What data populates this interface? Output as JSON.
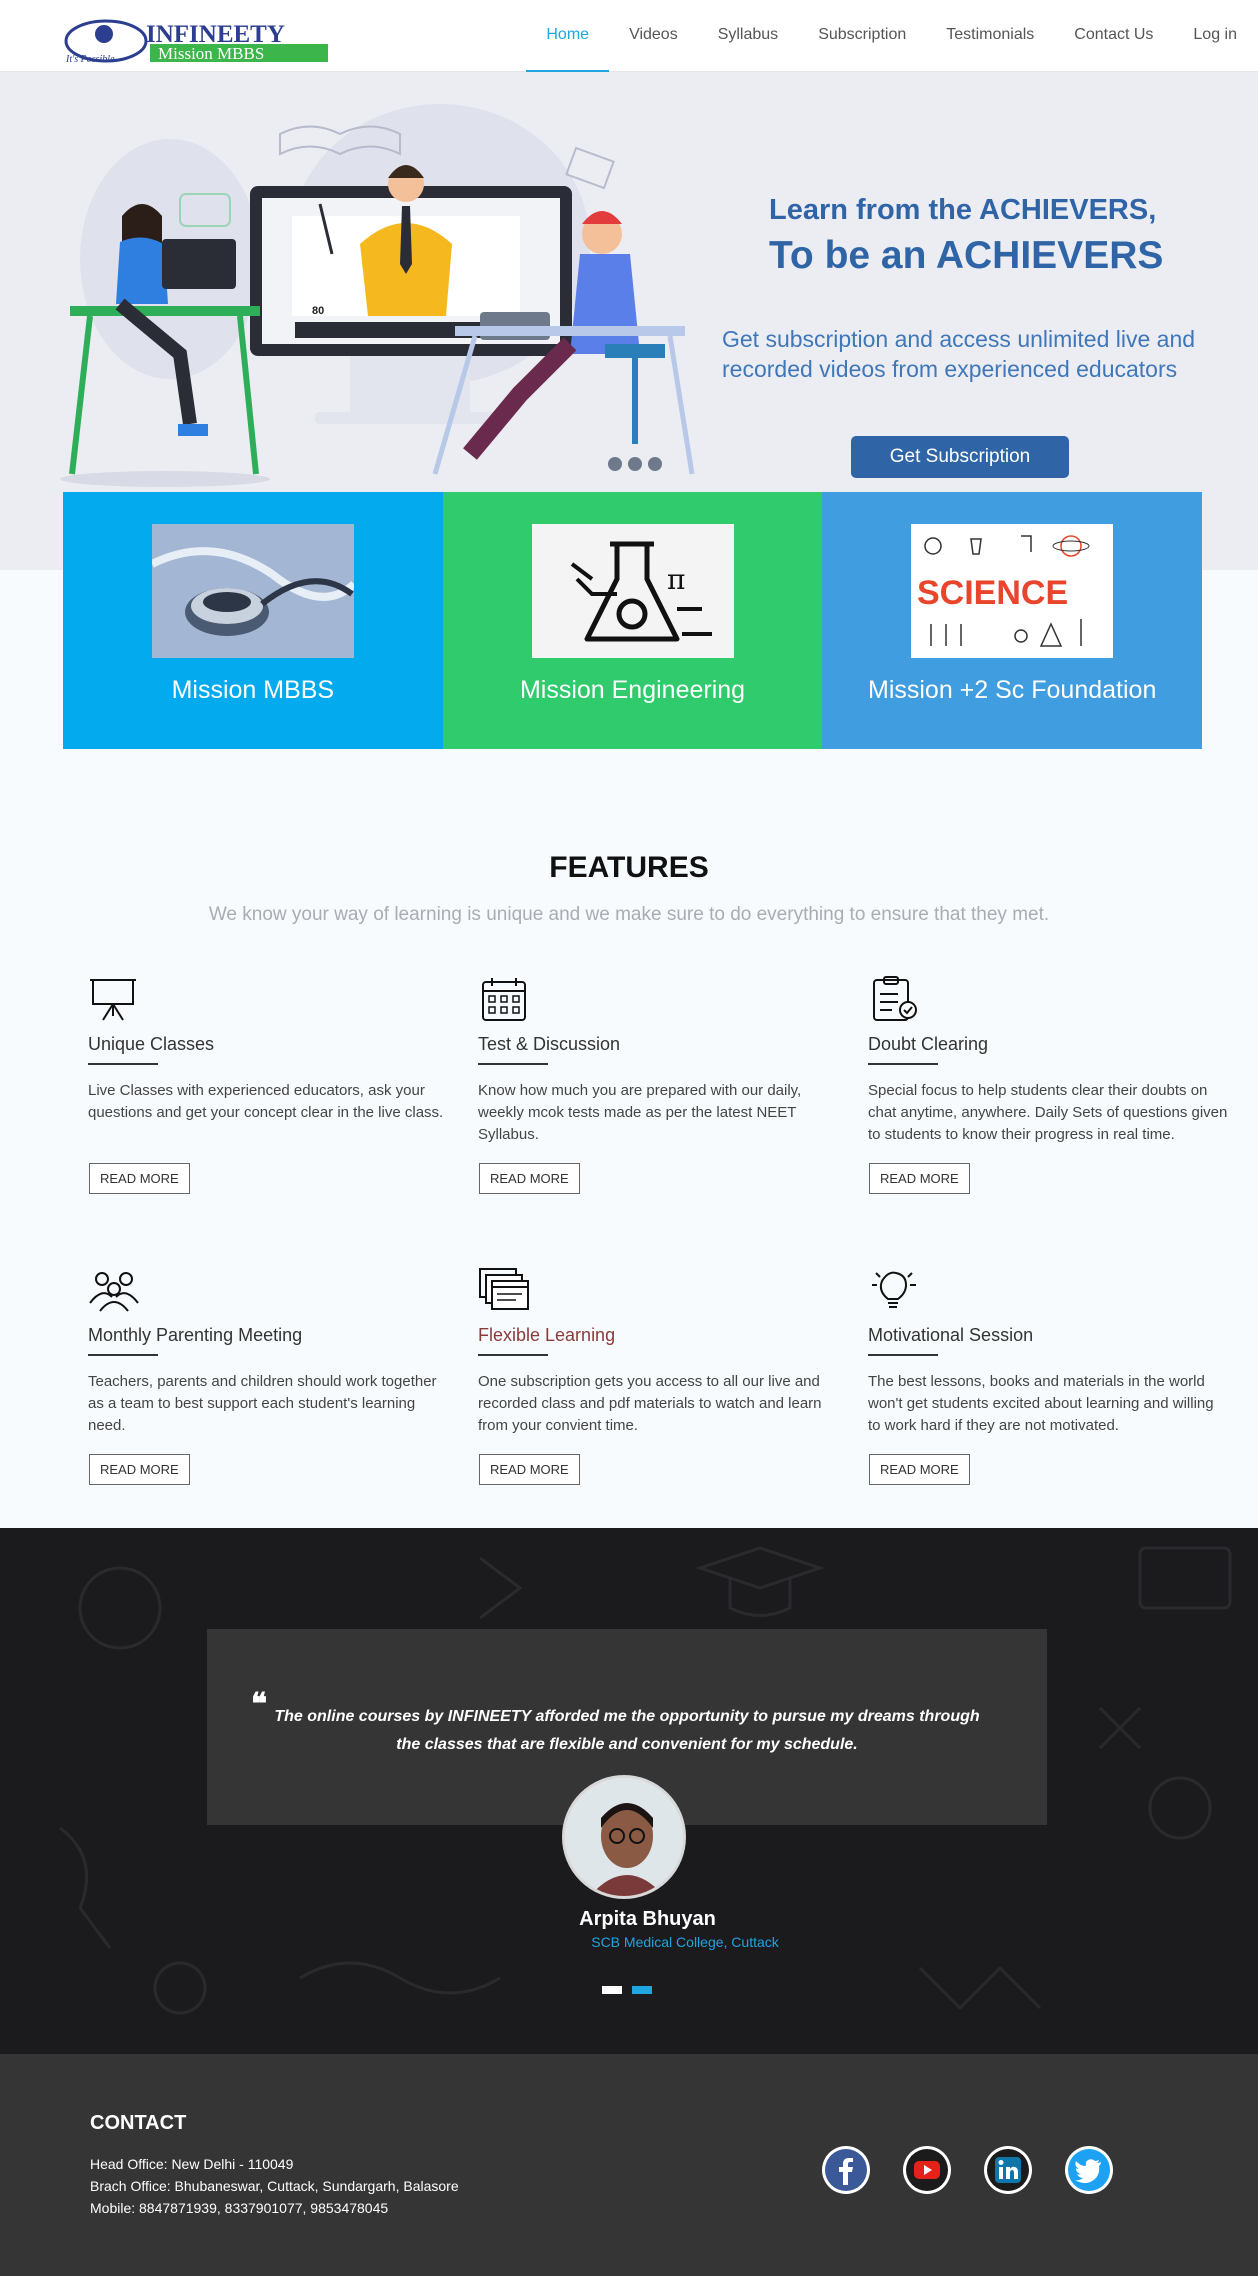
{
  "nav": {
    "logo_text": "INFINEETY",
    "logo_tagline": "It's Possible",
    "logo_sub": "Mission MBBS",
    "items": [
      {
        "label": "Home",
        "active": true
      },
      {
        "label": "Videos"
      },
      {
        "label": "Syllabus"
      },
      {
        "label": "Subscription"
      },
      {
        "label": "Testimonials"
      },
      {
        "label": "Contact Us"
      },
      {
        "label": "Log in"
      }
    ]
  },
  "hero": {
    "title_line1": "Learn from the ACHIEVERS,",
    "title_line2": "To be an ACHIEVERS",
    "subtitle": "Get subscription and access unlimited live and recorded videos from experienced educators",
    "cta": "Get Subscription",
    "video_score": "80"
  },
  "missions": [
    {
      "label": "Mission MBBS",
      "image": "stethoscope"
    },
    {
      "label": "Mission Engineering",
      "image": "flask-circuit-icon"
    },
    {
      "label": "Mission +2 Sc Foundation",
      "image": "science-doodle",
      "image_text": "SCIENCE"
    }
  ],
  "features": {
    "title": "FEATURES",
    "subtitle": "We know your way of learning is unique and we make sure to do everything to ensure that they met.",
    "items": [
      {
        "name": "Unique Classes",
        "icon": "presentation-board-icon",
        "desc": "Live Classes with experienced educators, ask your questions and get your concept clear in the live class.",
        "button": "READ MORE"
      },
      {
        "name": "Test & Discussion",
        "icon": "calendar-icon",
        "desc": "Know how much you are prepared with our daily, weekly mcok tests made as per the latest NEET Syllabus.",
        "button": "READ MORE"
      },
      {
        "name": "Doubt Clearing",
        "icon": "clipboard-check-icon",
        "desc": "Special focus to help students clear their doubts on chat anytime, anywhere. Daily Sets of questions given to students to know their progress in real time.",
        "button": "READ MORE"
      },
      {
        "name": "Monthly Parenting Meeting",
        "icon": "group-icon",
        "desc": "Teachers, parents and children should work together as a team to best support each student's learning need.",
        "button": "READ MORE"
      },
      {
        "name": "Flexible Learning",
        "icon": "browser-windows-icon",
        "desc": "One subscription gets you access to all our live and recorded class and pdf materials to watch and learn from your convient  time.",
        "button": "READ MORE"
      },
      {
        "name": "Motivational Session",
        "icon": "lightbulb-icon",
        "desc": "The best lessons, books and materials in the world won't get students excited about learning and willing to work hard if they are not motivated.",
        "button": "READ MORE"
      }
    ]
  },
  "testimonial": {
    "quote": "The online courses by INFINEETY afforded me the opportunity to pursue my dreams through the classes that are flexible and convenient for my schedule.",
    "name": "Arpita Bhuyan",
    "org": "SCB Medical College, Cuttack"
  },
  "footer": {
    "title": "CONTACT",
    "head_office": "Head Office: New Delhi - 110049",
    "branch_office": "Brach Office: Bhubaneswar, Cuttack, Sundargarh, Balasore",
    "mobile": "Mobile: 8847871939, 8337901077, 9853478045",
    "social": [
      {
        "name": "facebook-icon",
        "color": "#3b5998"
      },
      {
        "name": "youtube-icon",
        "color": "#e62117"
      },
      {
        "name": "linkedin-icon",
        "color": "#0e76a8"
      },
      {
        "name": "twitter-icon",
        "color": "#1da1f2"
      }
    ]
  },
  "colors": {
    "accent": "#1fa5e0",
    "hero_blue": "#2f65a6",
    "mission_mbbs": "#04aaee",
    "mission_engineering": "#2fcb6c",
    "mission_foundation": "#3f9de0"
  }
}
